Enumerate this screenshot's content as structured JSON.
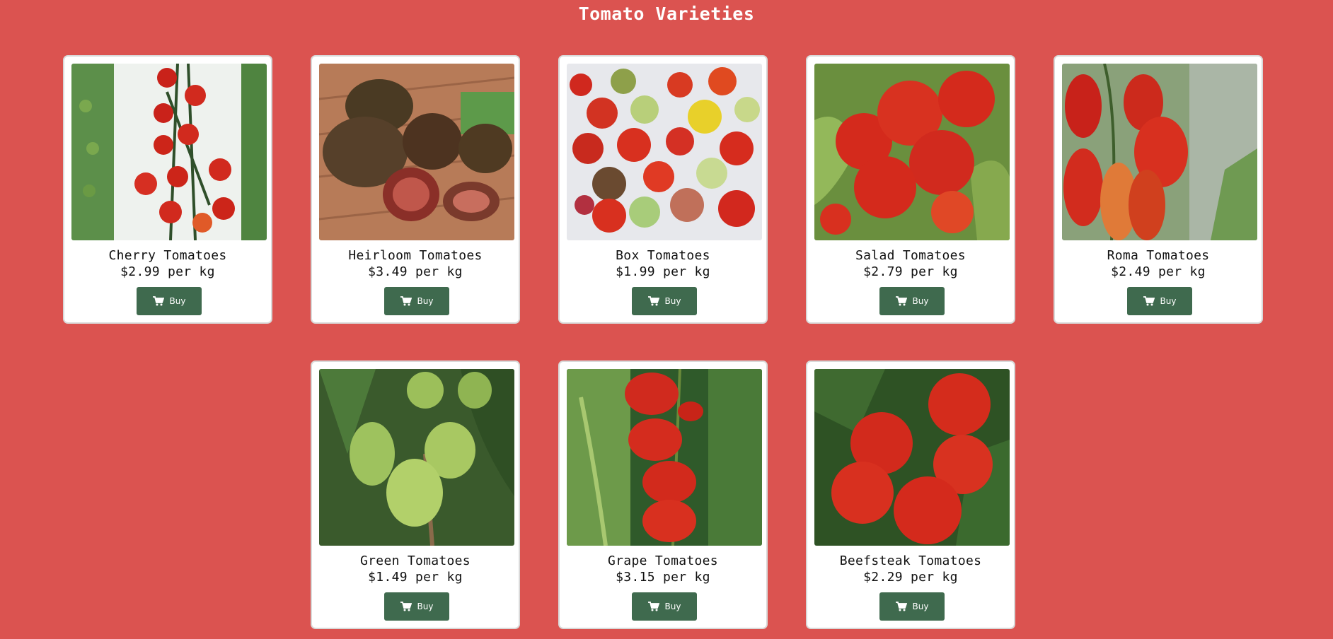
{
  "page": {
    "title": "Tomato Varieties"
  },
  "colors": {
    "background": "#db5350",
    "button": "#3f6a4e",
    "card": "#ffffff"
  },
  "products": [
    {
      "name": "Cherry Tomatoes",
      "price": "$2.99 per kg",
      "buy_label": "Buy",
      "icon": "cart-icon"
    },
    {
      "name": "Heirloom Tomatoes",
      "price": "$3.49 per kg",
      "buy_label": "Buy",
      "icon": "cart-icon"
    },
    {
      "name": "Box Tomatoes",
      "price": "$1.99 per kg",
      "buy_label": "Buy",
      "icon": "cart-icon"
    },
    {
      "name": "Salad Tomatoes",
      "price": "$2.79 per kg",
      "buy_label": "Buy",
      "icon": "cart-icon"
    },
    {
      "name": "Roma Tomatoes",
      "price": "$2.49 per kg",
      "buy_label": "Buy",
      "icon": "cart-icon"
    },
    {
      "name": "Green Tomatoes",
      "price": "$1.49 per kg",
      "buy_label": "Buy",
      "icon": "cart-icon"
    },
    {
      "name": "Grape Tomatoes",
      "price": "$3.15 per kg",
      "buy_label": "Buy",
      "icon": "cart-icon"
    },
    {
      "name": "Beefsteak Tomatoes",
      "price": "$2.29 per kg",
      "buy_label": "Buy",
      "icon": "cart-icon"
    }
  ]
}
